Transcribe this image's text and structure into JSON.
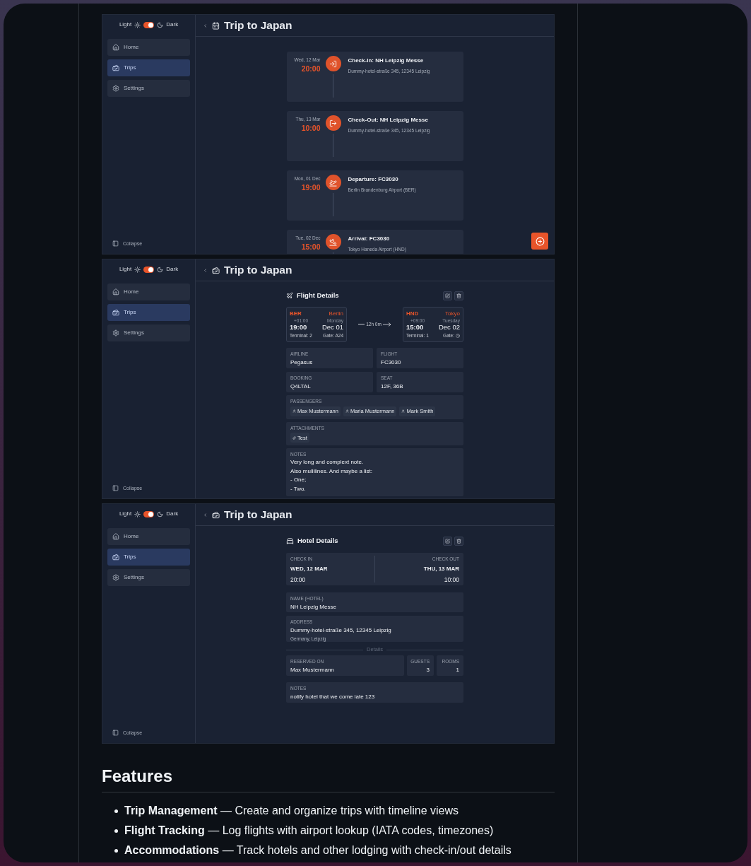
{
  "screens": [
    {
      "kind": "timeline",
      "theme": {
        "light_label": "Light",
        "dark_label": "Dark",
        "dark": true
      },
      "nav": [
        {
          "kind": "home",
          "label": "Home",
          "selected": false
        },
        {
          "kind": "trips",
          "label": "Trips",
          "selected": true
        },
        {
          "kind": "settings",
          "label": "Settings",
          "selected": false
        }
      ],
      "collapse": "Collapse",
      "title": "Trip to Japan",
      "events": [
        {
          "kind": "check_in",
          "date": "Wed, 12 Mar",
          "time": "20:00",
          "title": "Check-In: NH Leipzig Messe",
          "subtitle": "Dummy-hotel-straße 345, 12345 Leipzig"
        },
        {
          "kind": "check_out",
          "date": "Thu, 13 Mar",
          "time": "10:00",
          "title": "Check-Out: NH Leipzig Messe",
          "subtitle": "Dummy-hotel-straße 345, 12345 Leipzig"
        },
        {
          "kind": "departure",
          "date": "Mon, 01 Dec",
          "time": "19:00",
          "title": "Departure: FC3030",
          "subtitle": "Berlin Brandenburg Airport (BER)"
        },
        {
          "kind": "arrival",
          "date": "Tue, 02 Dec",
          "time": "15:00",
          "title": "Arrival: FC3030",
          "subtitle": "Tokyo Haneda Airport (HND)"
        }
      ]
    },
    {
      "kind": "flight",
      "theme": {
        "light_label": "Light",
        "dark_label": "Dark",
        "dark": true
      },
      "nav": [
        {
          "kind": "home",
          "label": "Home",
          "selected": false
        },
        {
          "kind": "trips",
          "label": "Trips",
          "selected": true
        },
        {
          "kind": "settings",
          "label": "Settings",
          "selected": false
        }
      ],
      "collapse": "Collapse",
      "title": "Trip to Japan",
      "details": {
        "heading": "Flight Details",
        "from": {
          "code": "BER",
          "city": "Berlin",
          "offset": "+01:00",
          "day": "Monday",
          "time": "19:00",
          "date": "Dec 01",
          "terminal": "Terminal: 2",
          "gate_label": "Gate:",
          "gate": "A24"
        },
        "duration": "12h 0m",
        "to": {
          "code": "HND",
          "city": "Tokyo",
          "offset": "+09:00",
          "day": "Tuesday",
          "time": "15:00",
          "date": "Dec 02",
          "terminal": "Terminal: 1",
          "gate_label": "Gate:"
        },
        "fields": [
          {
            "label": "AIRLINE",
            "value": "Pegasus"
          },
          {
            "label": "FLIGHT",
            "value": "FC3030"
          },
          {
            "label": "BOOKING",
            "value": "Q4LTAL"
          },
          {
            "label": "SEAT",
            "value": "12F, 36B"
          }
        ],
        "passengers": {
          "label": "PASSENGERS",
          "names": [
            "Max Mustermann",
            "Maria Mustermann",
            "Mark Smith"
          ]
        },
        "attachments": {
          "label": "ATTACHMENTS",
          "files": [
            "Test"
          ]
        },
        "notes": {
          "label": "NOTES",
          "lines": [
            "Very long and complext note.",
            "Also mullilines. And maybe a list:",
            "- One;",
            "- Two."
          ]
        }
      }
    },
    {
      "kind": "hotel",
      "theme": {
        "light_label": "Light",
        "dark_label": "Dark",
        "dark": true
      },
      "nav": [
        {
          "kind": "home",
          "label": "Home",
          "selected": false
        },
        {
          "kind": "trips",
          "label": "Trips",
          "selected": true
        },
        {
          "kind": "settings",
          "label": "Settings",
          "selected": false
        }
      ],
      "collapse": "Collapse",
      "title": "Trip to Japan",
      "details": {
        "heading": "Hotel Details",
        "check_in": {
          "label": "CHECK IN",
          "date": "WED, 12 MAR",
          "time": "20:00"
        },
        "check_out": {
          "label": "CHECK OUT",
          "date": "THU, 13 MAR",
          "time": "10:00"
        },
        "name": {
          "label": "NAME (HOTEL)",
          "value": "NH Leipzig Messe"
        },
        "address": {
          "label": "ADDRESS",
          "value": "Dummy-hotel-straße 345, 12345 Leipzig",
          "sub": "Germany, Leipzig"
        },
        "divider": "Details",
        "reserved": {
          "label": "RESERVED ON",
          "value": "Max Mustermann"
        },
        "guests": {
          "label": "GUESTS",
          "value": "3"
        },
        "rooms": {
          "label": "ROOMS",
          "value": "1"
        },
        "notes": {
          "label": "NOTES",
          "value": "notify hotel that we come late 123"
        }
      }
    }
  ],
  "features": {
    "heading": "Features",
    "items": [
      "**Trip Management** — Create and organize trips with timeline views",
      "**Flight Tracking** — Log flights with airport lookup (IATA codes, timezones)",
      "**Accommodations** — Track hotels and other lodging with check-in/out details"
    ]
  }
}
